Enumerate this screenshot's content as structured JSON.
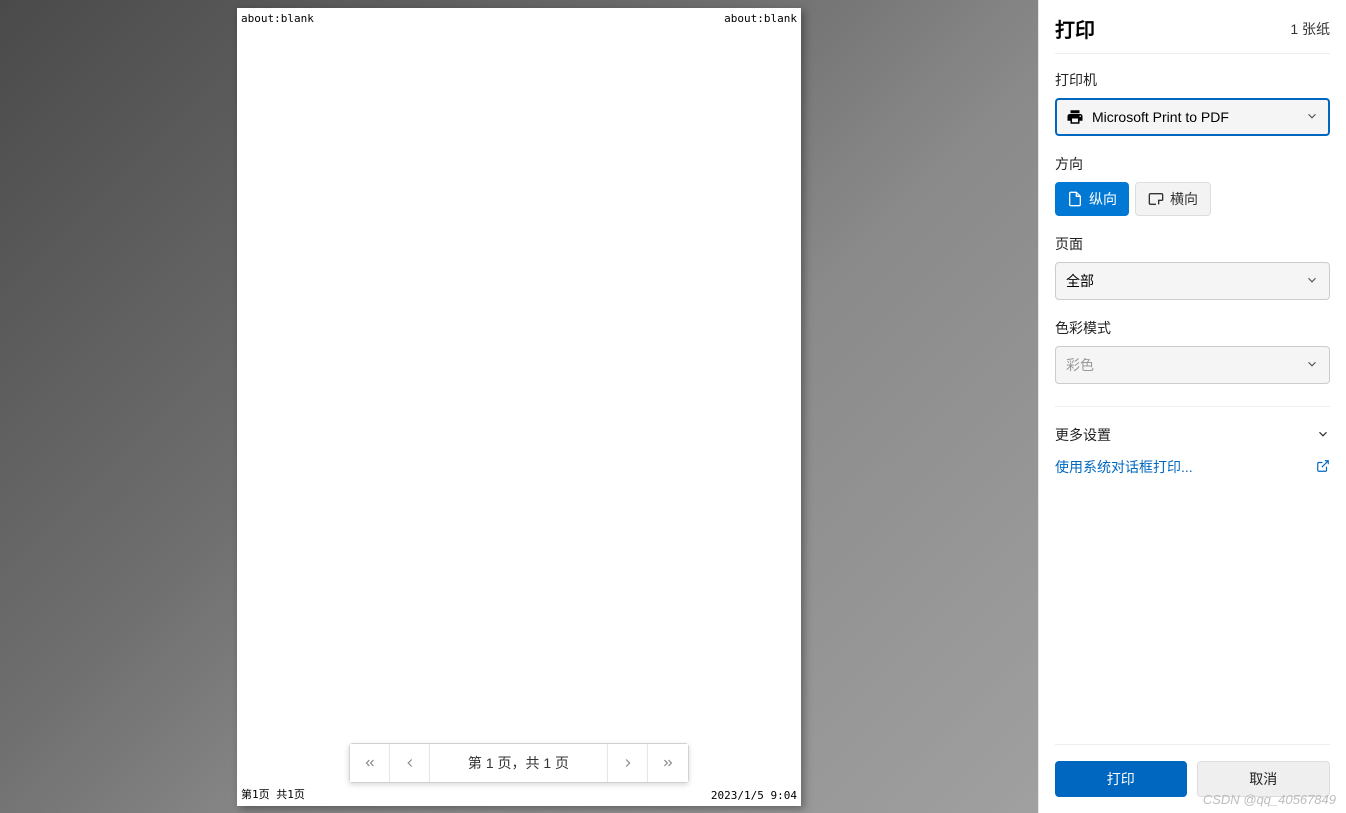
{
  "preview": {
    "header_left": "about:blank",
    "header_right": "about:blank",
    "footer_left": "第1页 共1页",
    "footer_right": "2023/1/5 9:04",
    "pager_label": "第 1 页，共 1 页"
  },
  "sidebar": {
    "title": "打印",
    "sheet_count": "1 张纸",
    "printer_label": "打印机",
    "printer_value": "Microsoft Print to PDF",
    "orientation_label": "方向",
    "orientation_portrait": "纵向",
    "orientation_landscape": "横向",
    "pages_label": "页面",
    "pages_value": "全部",
    "color_label": "色彩模式",
    "color_value": "彩色",
    "more_settings": "更多设置",
    "system_dialog": "使用系统对话框打印...",
    "print_btn": "打印",
    "cancel_btn": "取消"
  },
  "watermark": "CSDN @qq_40567849"
}
